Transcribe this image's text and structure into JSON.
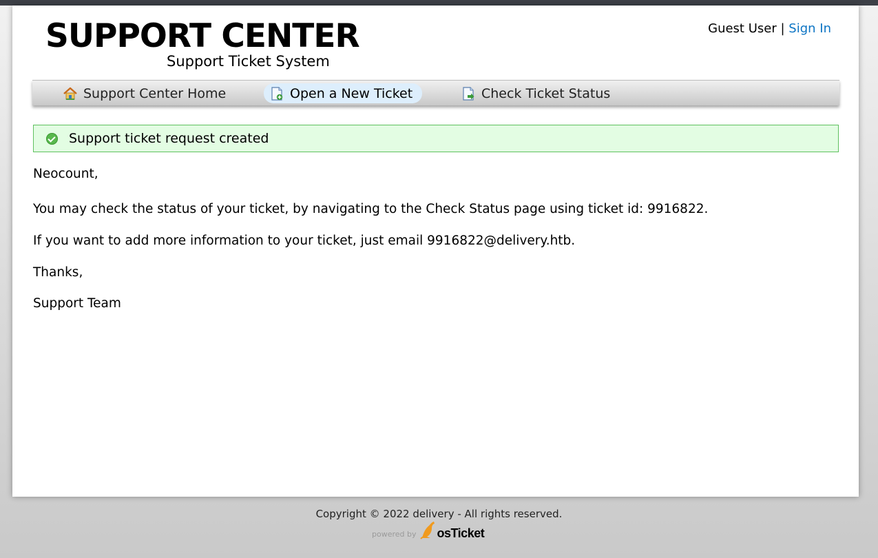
{
  "header": {
    "logo_title": "SUPPORT CENTER",
    "logo_subtitle": "Support Ticket System",
    "user_label": "Guest User",
    "separator": "|",
    "sign_in": "Sign In"
  },
  "nav": {
    "items": [
      {
        "label": "Support Center Home",
        "icon": "home-icon"
      },
      {
        "label": "Open a New Ticket",
        "icon": "new-ticket-icon",
        "active": true
      },
      {
        "label": "Check Ticket Status",
        "icon": "ticket-status-icon"
      }
    ]
  },
  "notice": {
    "text": "Support ticket request created",
    "icon": "check-circle-icon",
    "color": "#58b84d"
  },
  "message": {
    "greeting": "Neocount,",
    "line1": "You may check the status of your ticket, by navigating to the Check Status page using ticket id: 9916822.",
    "line2": "If you want to add more information to your ticket, just email 9916822@delivery.htb.",
    "thanks": "Thanks,",
    "signature": "Support Team"
  },
  "footer": {
    "copyright": "Copyright © 2022 delivery - All rights reserved.",
    "powered_by": "powered by",
    "brand": "osTicket"
  },
  "colors": {
    "link": "#0b74c4",
    "notice_bg": "#e3fde3",
    "notice_border": "#5fc05f",
    "topbar": "#3d4047"
  }
}
